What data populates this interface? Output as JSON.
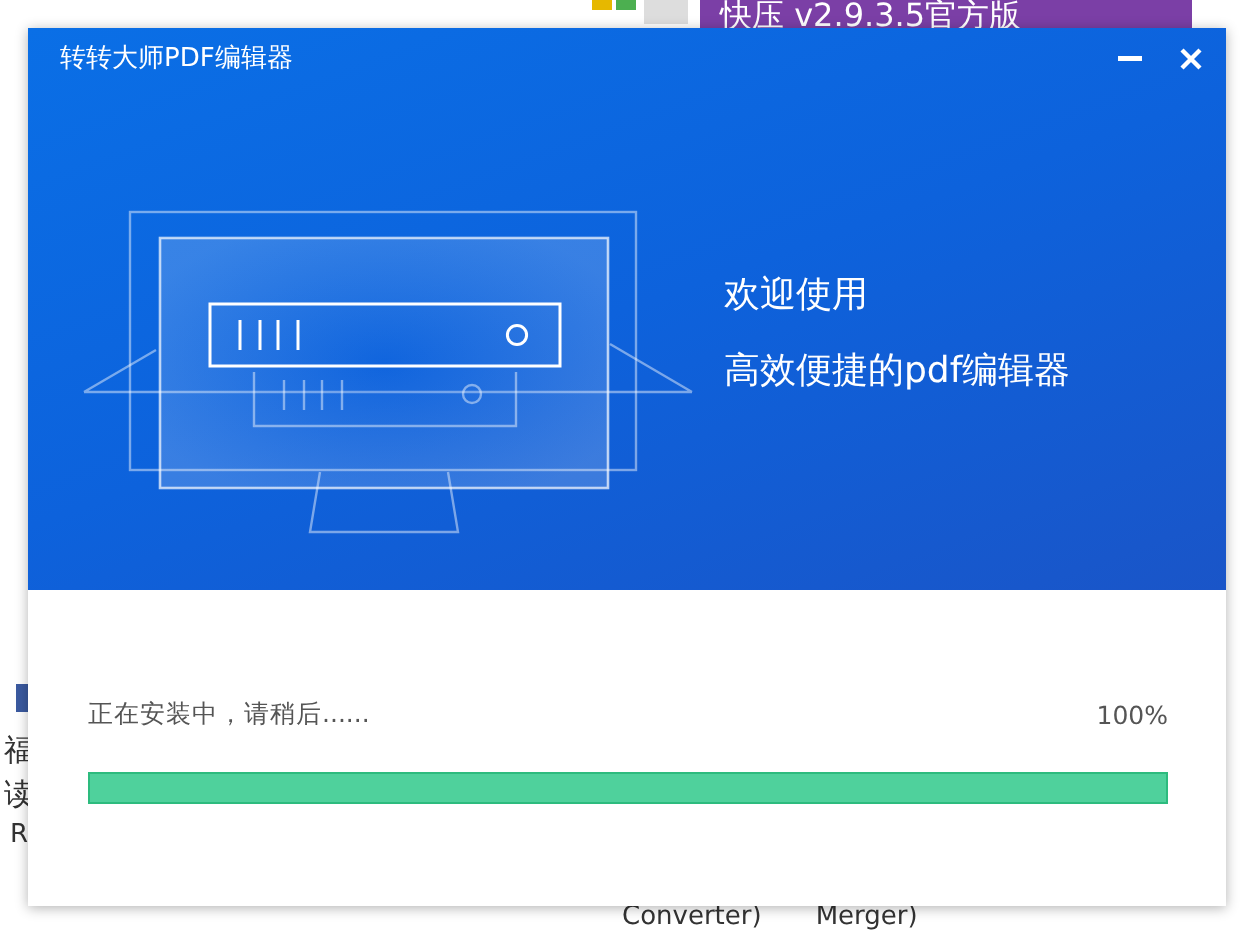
{
  "desktop": {
    "banner_text": "快压 v2.9.3.5官方版",
    "side_texts": [
      "福",
      "读",
      "R"
    ],
    "bottom_texts": [
      "Converter)",
      "Merger)"
    ]
  },
  "window": {
    "title": "转转大师PDF编辑器"
  },
  "welcome_lines": [
    "欢迎使用",
    "高效便捷的pdf编辑器"
  ],
  "progress": {
    "status": "正在安装中，请稍后......",
    "reading": "100%",
    "level": 1
  }
}
